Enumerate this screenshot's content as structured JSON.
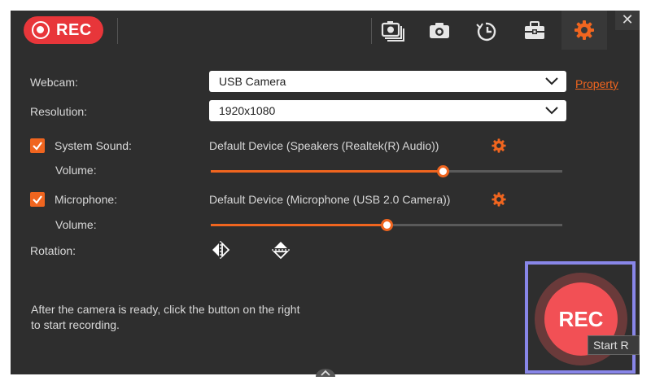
{
  "toolbar": {
    "rec_label": "REC",
    "icons": [
      "screenshot-stack-icon",
      "camera-icon",
      "schedule-clock-icon",
      "toolbox-icon",
      "settings-gear-icon"
    ],
    "close_label": "✕"
  },
  "form": {
    "webcam_label": "Webcam:",
    "webcam_value": "USB Camera",
    "property_link": "Property",
    "resolution_label": "Resolution:",
    "resolution_value": "1920x1080",
    "system_sound_label": "System Sound:",
    "system_sound_checked": true,
    "system_sound_device": "Default Device (Speakers (Realtek(R) Audio))",
    "system_volume_label": "Volume:",
    "system_volume": 0.66,
    "microphone_label": "Microphone:",
    "microphone_checked": true,
    "microphone_device": "Default Device (Microphone (USB 2.0 Camera))",
    "mic_volume_label": "Volume:",
    "mic_volume": 0.5,
    "rotation_label": "Rotation:"
  },
  "info": {
    "line1": "After the camera is ready, click the button on the right",
    "line2": "to start recording."
  },
  "record_button": {
    "label": "REC",
    "tooltip": "Start R"
  },
  "colors": {
    "accent": "#f0651f",
    "rec_red": "#e8363a",
    "panel": "#2e2e2e",
    "highlight_box": "#8886e8"
  }
}
